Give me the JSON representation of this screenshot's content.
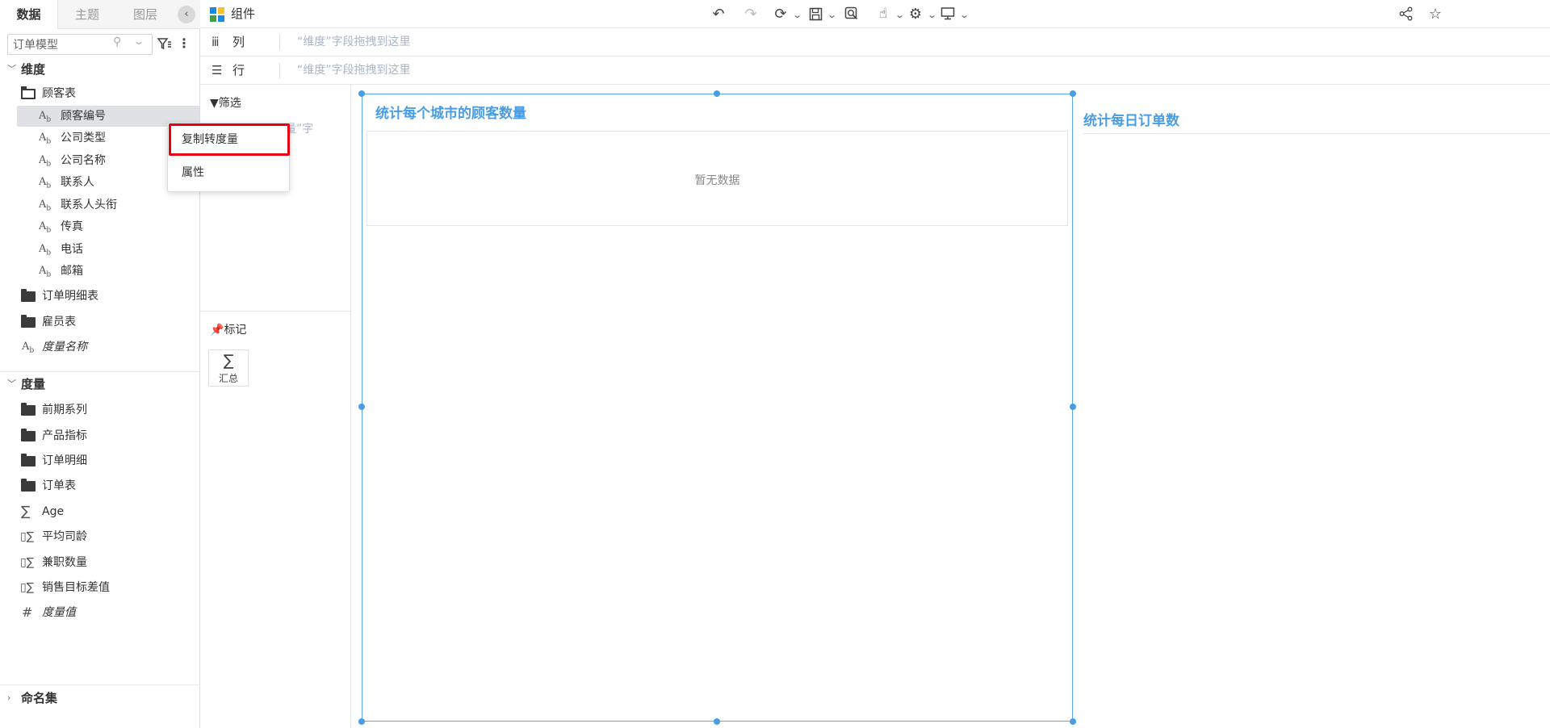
{
  "left_panel": {
    "tabs": [
      "数据",
      "主题",
      "图层"
    ],
    "model_value": "订单模型",
    "dimensions_label": "维度",
    "customer_table": "顾客表",
    "customer_fields": [
      "顾客编号",
      "公司类型",
      "公司名称",
      "联系人",
      "联系人头衔",
      "传真",
      "电话",
      "邮箱"
    ],
    "dim_folders": [
      "订单明细表",
      "雇员表"
    ],
    "dim_measure_names": "度量名称",
    "measures_label": "度量",
    "measure_folders": [
      "前期系列",
      "产品指标",
      "订单明细",
      "订单表"
    ],
    "measure_fields": [
      "Age",
      "平均司龄",
      "兼职数量",
      "销售目标差值"
    ],
    "measure_values": "度量值",
    "named_sets_label": "命名集"
  },
  "context_menu": {
    "items": [
      "复制转度量",
      "属性"
    ]
  },
  "toolbar": {
    "component_label": "组件"
  },
  "shelves": {
    "columns_label": "列",
    "rows_label": "行",
    "hint": "“维度”字段拖拽到这里"
  },
  "side": {
    "filter_label": "筛选",
    "filter_hint": "量”字",
    "marks_label": "标记",
    "sum_label": "汇总"
  },
  "canvas": {
    "widget1_title": "统计每个城市的顾客数量",
    "widget1_empty": "暂无数据",
    "widget2_title": "统计每日订单数"
  },
  "colors": {
    "accent": "#4a9de4",
    "highlight_box": "#e60012",
    "hint_text": "#a9b6c8"
  }
}
